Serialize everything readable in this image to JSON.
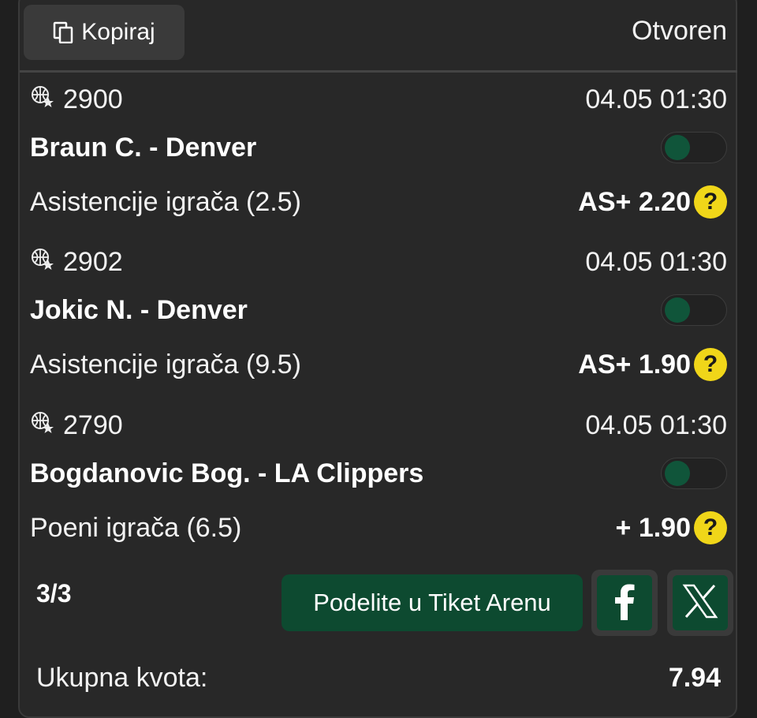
{
  "header": {
    "copy_label": "Kopiraj",
    "copy_icon": "copy-icon",
    "status": "Otvoren"
  },
  "bets": [
    {
      "code": "2900",
      "sport_icon": "basketball-star-icon",
      "datetime": "04.05 01:30",
      "player": "Braun C. - Denver",
      "market": "Asistencije igrača (2.5)",
      "odds": "AS+ 2.20",
      "help": "?"
    },
    {
      "code": "2902",
      "sport_icon": "basketball-star-icon",
      "datetime": "04.05 01:30",
      "player": "Jokic N. - Denver",
      "market": "Asistencije igrača (9.5)",
      "odds": "AS+ 1.90",
      "help": "?"
    },
    {
      "code": "2790",
      "sport_icon": "basketball-star-icon",
      "datetime": "04.05 01:30",
      "player": "Bogdanovic Bog. - LA Clippers",
      "market": "Poeni igrača (6.5)",
      "odds": "+ 1.90",
      "help": "?"
    }
  ],
  "footer": {
    "count": "3/3",
    "share_label": "Podelite u Tiket Arenu",
    "facebook_icon": "facebook-icon",
    "x_icon": "x-logo-icon",
    "total_label": "Ukupna kvota:",
    "total_value": "7.94"
  },
  "colors": {
    "background": "#1f1f1f",
    "card": "#282828",
    "accent_green": "#0d4a30",
    "help_yellow": "#f0d619"
  }
}
